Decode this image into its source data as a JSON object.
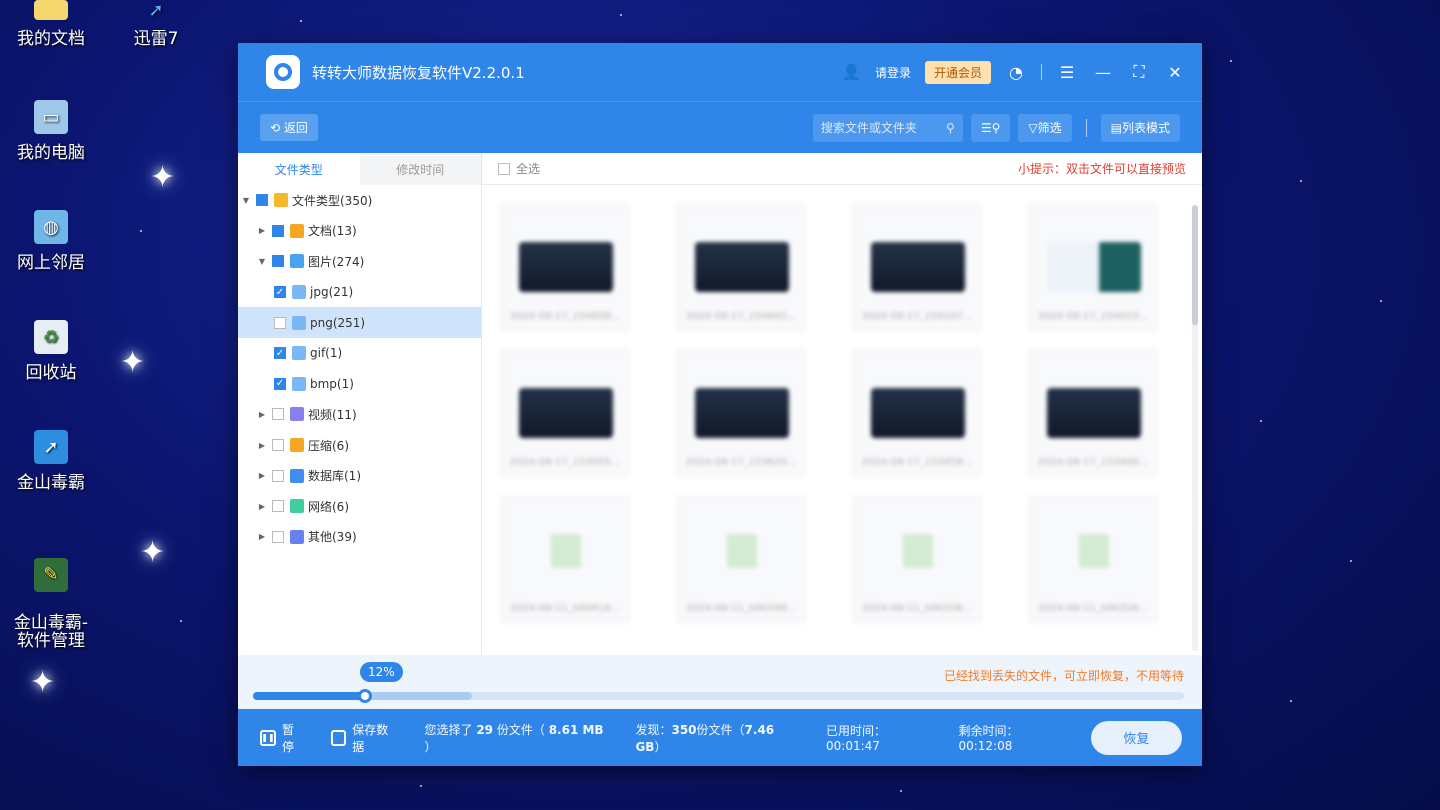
{
  "desktop": {
    "icons": [
      {
        "label": "我的文档"
      },
      {
        "label": "迅雷7"
      },
      {
        "label": "我的电脑"
      },
      {
        "label": "网上邻居"
      },
      {
        "label": "回收站"
      },
      {
        "label": "金山毒霸"
      },
      {
        "label": "金山毒霸-\n软件管理"
      }
    ]
  },
  "window": {
    "title": "转转大师数据恢复软件V2.2.0.1",
    "login": "请登录",
    "vip": "开通会员"
  },
  "toolbar": {
    "back": "返回",
    "search_placeholder": "搜索文件或文件夹",
    "filter": "筛选",
    "view_mode": "列表模式"
  },
  "left_tabs": {
    "file_type": "文件类型",
    "modified_time": "修改时间"
  },
  "tree": [
    {
      "label": "文件类型(350)",
      "level": 0,
      "expanded": true,
      "check": "full",
      "icon_color": "#f5b829"
    },
    {
      "label": "文档(13)",
      "level": 1,
      "expanded": false,
      "check": "full",
      "icon_color": "#f5a623"
    },
    {
      "label": "图片(274)",
      "level": 1,
      "expanded": true,
      "check": "full",
      "icon_color": "#4aa3f0"
    },
    {
      "label": "jpg(21)",
      "level": 2,
      "check": "checked",
      "icon_color": "#7ab8f5"
    },
    {
      "label": "png(251)",
      "level": 2,
      "check": "none",
      "icon_color": "#7ab8f5",
      "selected": true
    },
    {
      "label": "gif(1)",
      "level": 2,
      "check": "checked",
      "icon_color": "#7ab8f5"
    },
    {
      "label": "bmp(1)",
      "level": 2,
      "check": "checked",
      "icon_color": "#7ab8f5"
    },
    {
      "label": "视频(11)",
      "level": 1,
      "expanded": false,
      "check": "none",
      "icon_color": "#8a7df0"
    },
    {
      "label": "压缩(6)",
      "level": 1,
      "expanded": false,
      "check": "none",
      "icon_color": "#f5a623"
    },
    {
      "label": "数据库(1)",
      "level": 1,
      "expanded": false,
      "check": "none",
      "icon_color": "#3d8ef0"
    },
    {
      "label": "网络(6)",
      "level": 1,
      "expanded": false,
      "check": "none",
      "icon_color": "#3fcf9f"
    },
    {
      "label": "其他(39)",
      "level": 1,
      "expanded": false,
      "check": "none",
      "icon_color": "#6a7ff0"
    }
  ],
  "main": {
    "select_all": "全选",
    "tip": "小提示：双击文件可以直接预览",
    "cards": [
      {
        "name": "2024-09-17_154658...",
        "thumb": "dark"
      },
      {
        "name": "2024-09-17_154642...",
        "thumb": "dark"
      },
      {
        "name": "2024-09-17_154107...",
        "thumb": "dark"
      },
      {
        "name": "2024-09-17_154023...",
        "thumb": "light"
      },
      {
        "name": "2024-09-17_153955...",
        "thumb": "dark"
      },
      {
        "name": "2024-09-17_153620...",
        "thumb": "dark"
      },
      {
        "name": "2024-09-17_153458...",
        "thumb": "dark"
      },
      {
        "name": "2024-09-17_153400...",
        "thumb": "dark"
      },
      {
        "name": "2024-09-11_040416...",
        "thumb": "img"
      },
      {
        "name": "2024-09-11_040348...",
        "thumb": "img"
      },
      {
        "name": "2024-09-11_040336...",
        "thumb": "img"
      },
      {
        "name": "2024-09-11_040326...",
        "thumb": "img"
      }
    ]
  },
  "progress": {
    "percent_label": "12%",
    "percent": 0.12,
    "buffered": 0.235,
    "message": "已经找到丢失的文件，可立即恢复，不用等待"
  },
  "bottom": {
    "pause": "暂停",
    "save": "保存数据",
    "selected_prefix": "您选择了",
    "selected_count": "29",
    "selected_mid": "份文件（",
    "selected_size": "8.61 MB",
    "selected_suffix": "）",
    "found_prefix": "发现：",
    "found_count": "350",
    "found_mid": "份文件（",
    "found_size": "7.46 GB",
    "found_suffix": "）",
    "elapsed": "已用时间：00:01:47",
    "remaining": "剩余时间：00:12:08",
    "recover": "恢复"
  }
}
